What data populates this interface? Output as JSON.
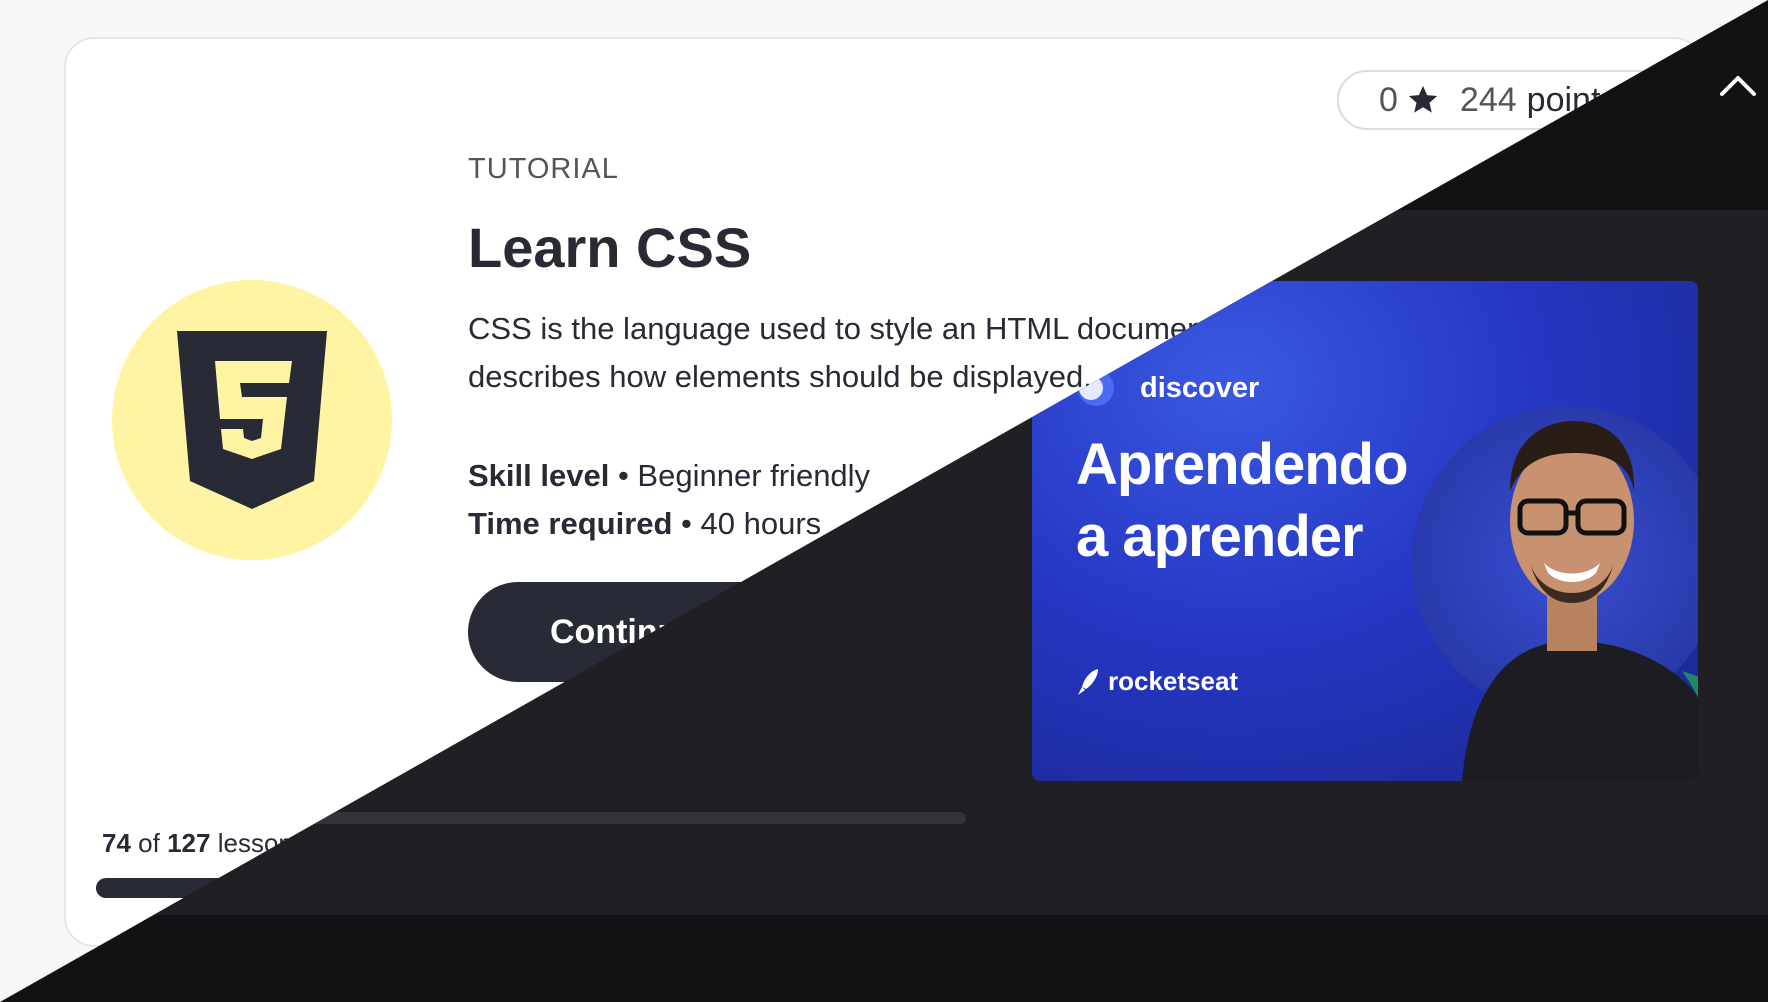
{
  "course": {
    "type_label": "TUTORIAL",
    "title": "Learn CSS",
    "description": "CSS is the language used to style an HTML document, and describes how elements should be displayed.",
    "skill_label": "Skill level",
    "skill_value": "Beginner friendly",
    "time_label": "Time required",
    "time_value": "40 hours",
    "continue_label": "Continue",
    "logo_icon": "css3-shield-icon",
    "logo_bg_color": "#fff4a3"
  },
  "points": {
    "stars": "0",
    "points_value": "244",
    "points_word": "points",
    "star_icon": "star-icon"
  },
  "progress": {
    "completed_lessons": "74",
    "of_word": "of",
    "total_lessons": "127",
    "lessons_word": "lessons",
    "fraction": 0.583
  },
  "video": {
    "discover_label": "discover",
    "title_line1": "Aprendendo",
    "title_line2": "a aprender",
    "brand": "rocketseat",
    "progress_fraction": 0.23,
    "progress_color": "#04d361",
    "thumbnail_color": "#2537c4"
  },
  "dark_ui": {
    "collapse_icon": "chevron-up-icon"
  }
}
